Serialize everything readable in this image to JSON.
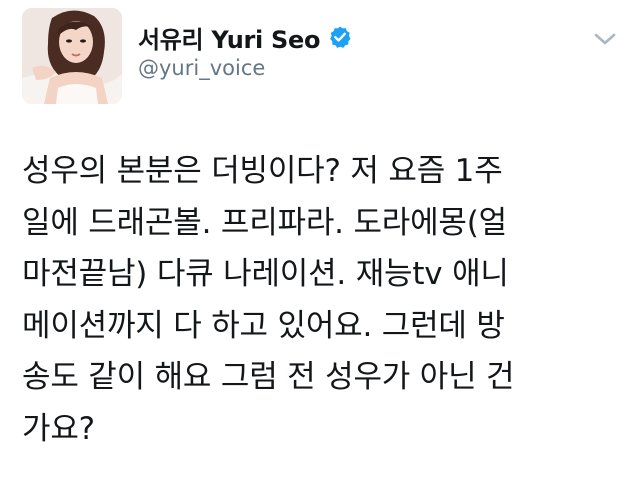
{
  "author": {
    "display_name": "서유리 Yuri Seo",
    "handle": "@yuri_voice",
    "verified": true
  },
  "icons": {
    "verified": "verified-badge-icon",
    "caret": "chevron-down-icon",
    "accent_color": "#1da1f2"
  },
  "tweet": {
    "lines": [
      "성우의 본분은 더빙이다? 저 요즘 1주",
      "일에 드래곤볼. 프리파라. 도라에몽(얼",
      "마전끝남) 다큐 나레이션. 재능tv 애니",
      "메이션까지 다 하고 있어요. 그런데 방",
      "송도 같이 해요 그럼 전 성우가 아닌 건",
      "가요?"
    ]
  }
}
